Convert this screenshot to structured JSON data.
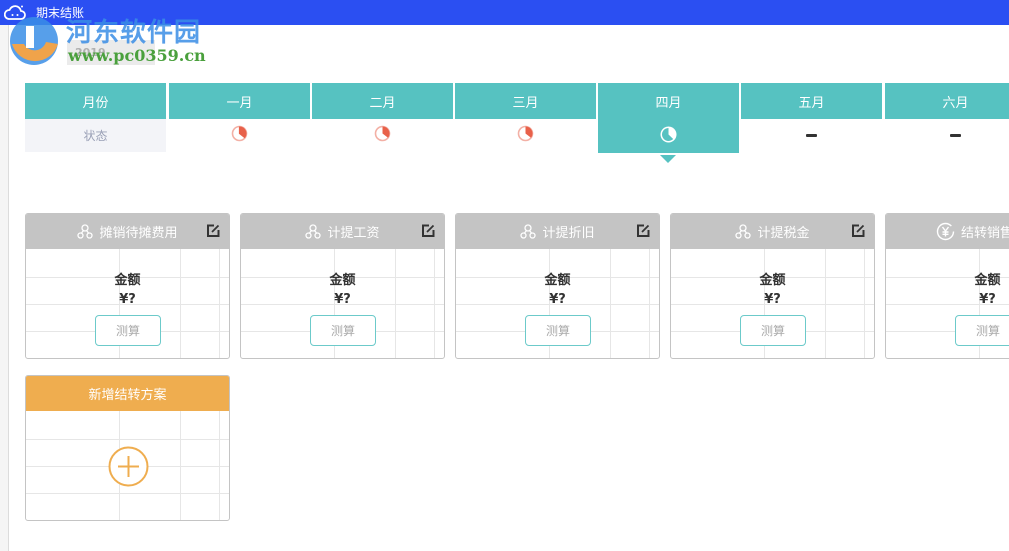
{
  "window": {
    "title": "期末结账",
    "icon": "cloud-icon"
  },
  "year_selector": {
    "value": "2019"
  },
  "watermark": {
    "line1": "河东软件园",
    "line2": "www.pc0359.cn"
  },
  "month_table": {
    "header_label": "月份",
    "status_label": "状态",
    "months": [
      {
        "label": "一月",
        "status": "partial",
        "status_icon": "pie-progress-icon"
      },
      {
        "label": "二月",
        "status": "partial",
        "status_icon": "pie-progress-icon"
      },
      {
        "label": "三月",
        "status": "partial",
        "status_icon": "pie-progress-icon"
      },
      {
        "label": "四月",
        "status": "current",
        "status_icon": "clock-pie-icon",
        "active": true
      },
      {
        "label": "五月",
        "status": "none",
        "status_text": "-"
      },
      {
        "label": "六月",
        "status": "none",
        "status_text": "-"
      }
    ]
  },
  "cards": [
    {
      "title": "摊销待摊费用",
      "icon": "share-nodes-icon",
      "amount_label": "金额",
      "amount_value": "¥?",
      "button": "测算",
      "editable": true
    },
    {
      "title": "计提工资",
      "icon": "share-nodes-icon",
      "amount_label": "金额",
      "amount_value": "¥?",
      "button": "测算",
      "editable": true
    },
    {
      "title": "计提折旧",
      "icon": "share-nodes-icon",
      "amount_label": "金额",
      "amount_value": "¥?",
      "button": "测算",
      "editable": true
    },
    {
      "title": "计提税金",
      "icon": "share-nodes-icon",
      "amount_label": "金额",
      "amount_value": "¥?",
      "button": "测算",
      "editable": true
    },
    {
      "title": "结转销售成本",
      "icon": "yen-circle-icon",
      "amount_label": "金额",
      "amount_value": "¥?",
      "button": "测算",
      "editable": false
    }
  ],
  "add_card": {
    "title": "新增结转方案",
    "icon": "plus-circle-icon"
  },
  "colors": {
    "teal": "#56c2c1",
    "orange": "#efad4f",
    "card_header_gray": "#c4c4c4",
    "pie_red": "#e8614a",
    "titlebar_blue": "#2b4ff2"
  }
}
